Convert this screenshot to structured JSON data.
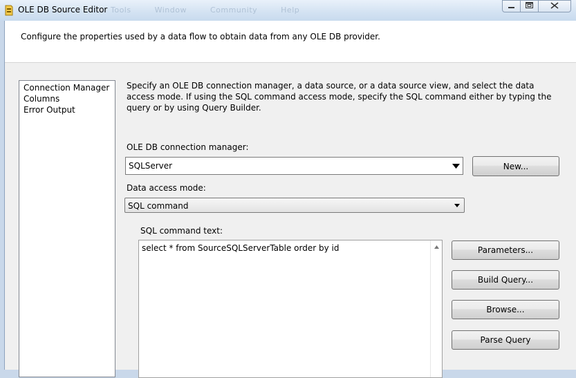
{
  "window": {
    "title": "OLE DB Source Editor",
    "background_menu": [
      "Tools",
      "Window",
      "Community",
      "Help"
    ]
  },
  "header": {
    "text": "Configure the properties used by a data flow to obtain data from any OLE DB provider."
  },
  "nav": {
    "items": [
      {
        "label": "Connection Manager",
        "selected": true
      },
      {
        "label": "Columns"
      },
      {
        "label": "Error Output"
      }
    ]
  },
  "main": {
    "description": "Specify an OLE DB connection manager, a data source, or a data source view, and select the data access mode. If using the SQL command access mode, specify the SQL command either by typing the query or by using Query Builder.",
    "connection_manager_label": "OLE DB connection manager:",
    "connection_manager_value": "SQLServer",
    "new_button": "New...",
    "access_mode_label": "Data access mode:",
    "access_mode_value": "SQL command",
    "sql_label": "SQL command text:",
    "sql_text": "select * from SourceSQLServerTable order by id",
    "buttons": {
      "parameters": "Parameters...",
      "build_query": "Build Query...",
      "browse": "Browse...",
      "parse_query": "Parse Query"
    }
  },
  "icons": {
    "title": "ssis-package-icon",
    "minimize": "minimize-icon",
    "maximize": "maximize-icon",
    "close": "close-icon",
    "dropdown": "chevron-down-icon",
    "scroll_up": "scroll-up-icon"
  }
}
